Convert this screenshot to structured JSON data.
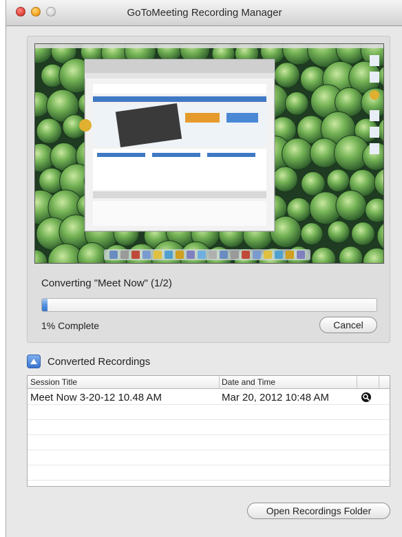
{
  "window": {
    "title": "GoToMeeting Recording Manager"
  },
  "conversion": {
    "status_text": "Converting \"Meet Now\" (1/2)",
    "progress_percent": 1,
    "percent_label": "1% Complete",
    "cancel_label": "Cancel"
  },
  "converted": {
    "section_title": "Converted Recordings",
    "columns": [
      "Session Title",
      "Date and Time"
    ],
    "rows": [
      {
        "title": "Meet Now 3-20-12 10.48 AM",
        "datetime": "Mar 20, 2012 10:48 AM",
        "icon": "magnifier-icon"
      }
    ]
  },
  "footer": {
    "open_folder_label": "Open Recordings Folder"
  },
  "colors": {
    "progress": "#4f8fde",
    "accent": "#3a74d0"
  }
}
